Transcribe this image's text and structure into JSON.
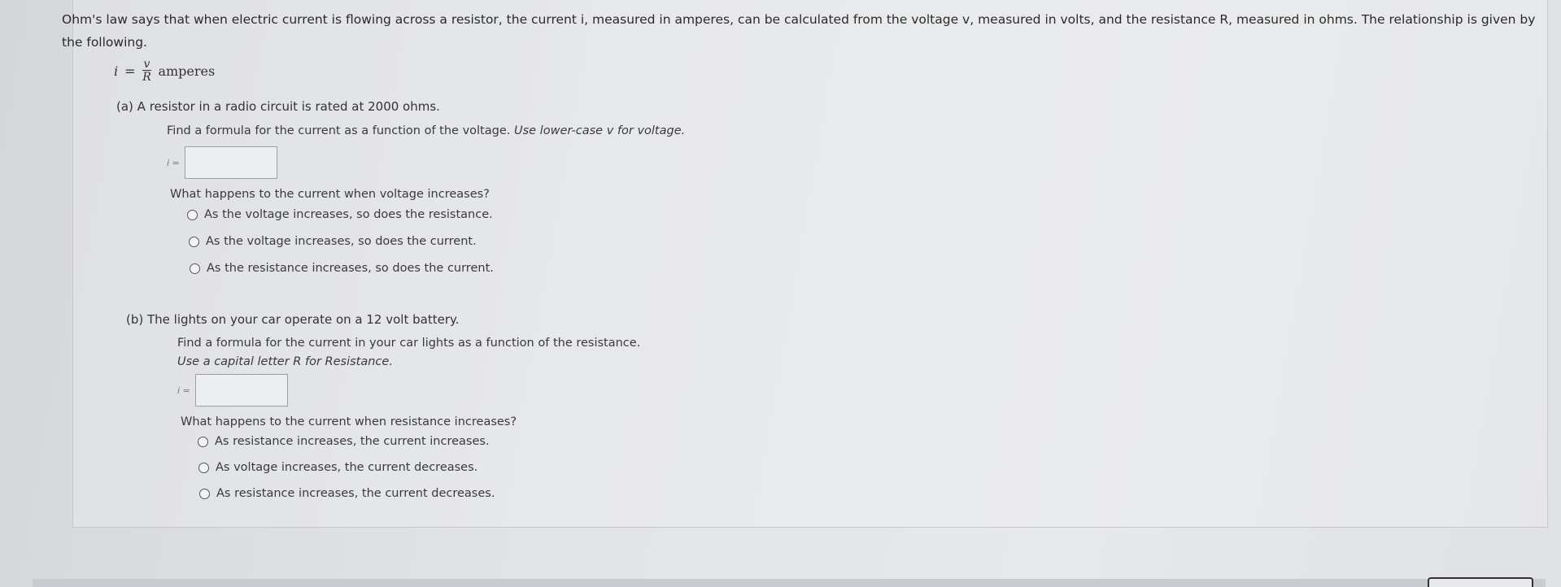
{
  "intro": {
    "text": "Ohm's law says that when electric current is flowing across a resistor, the current i, measured in amperes, can be calculated from the voltage v, measured in volts, and the resistance R, measured in ohms. The relationship is given by the following."
  },
  "formula": {
    "lhs": "i",
    "equals": "=",
    "numerator": "v",
    "denominator": "R",
    "unit": "amperes"
  },
  "part_a": {
    "title": "(a) A resistor in a radio circuit is rated at 2000 ohms.",
    "instruction": "Find a formula for the current as a function of the voltage.",
    "hint": "Use lower-case v for voltage.",
    "answer_label": "i =",
    "answer_value": "",
    "question": "What happens to the current when voltage increases?",
    "options": [
      "As the voltage increases, so does the resistance.",
      "As the voltage increases, so does the current.",
      "As the resistance increases, so does the current."
    ]
  },
  "part_b": {
    "title": "(b) The lights on your car operate on a 12 volt battery.",
    "instruction": "Find a formula for the current in your car lights as a function of the resistance.",
    "hint": "Use a capital letter R for Resistance.",
    "answer_label": "i =",
    "answer_value": "",
    "question": "What happens to the current when resistance increases?",
    "options": [
      "As resistance increases, the current increases.",
      "As voltage increases, the current decreases.",
      "As resistance increases, the current decreases."
    ]
  }
}
